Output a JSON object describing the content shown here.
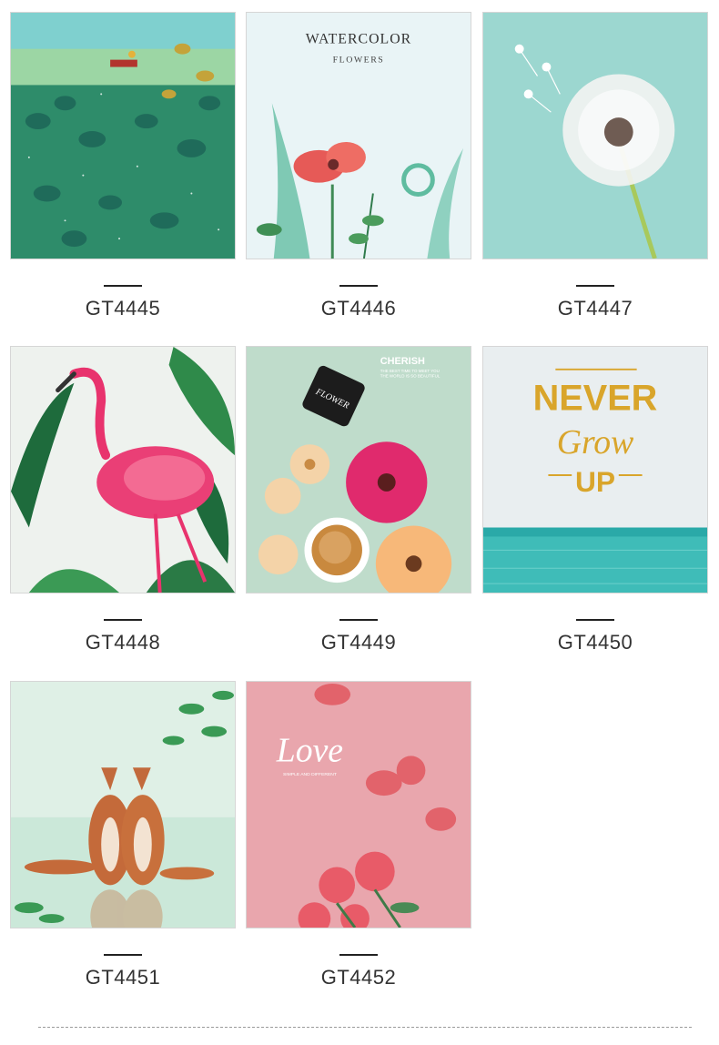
{
  "products": [
    {
      "code": "GT4445"
    },
    {
      "code": "GT4446",
      "art_title": "WATERCOLOR",
      "art_subtitle": "FLOWERS"
    },
    {
      "code": "GT4447"
    },
    {
      "code": "GT4448"
    },
    {
      "code": "GT4449",
      "art_title": "CHERISH",
      "art_line1": "THE BEST TIME TO MEET YOU",
      "art_line2": "THE WORLD IS SO BEAUTIFUL",
      "tag_text": "FLOWER"
    },
    {
      "code": "GT4450",
      "art_line1": "NEVER",
      "art_line2": "Grow",
      "art_line3": "UP"
    },
    {
      "code": "GT4451"
    },
    {
      "code": "GT4452",
      "art_title": "Love",
      "art_subtitle": "SIMPLE AND DIFFERENT"
    }
  ],
  "colors": {
    "label": "#333333",
    "border": "#d6d6d6",
    "accent_gold": "#d9a52b",
    "accent_pink": "#e8336d",
    "sea": "#4cc4c0"
  }
}
